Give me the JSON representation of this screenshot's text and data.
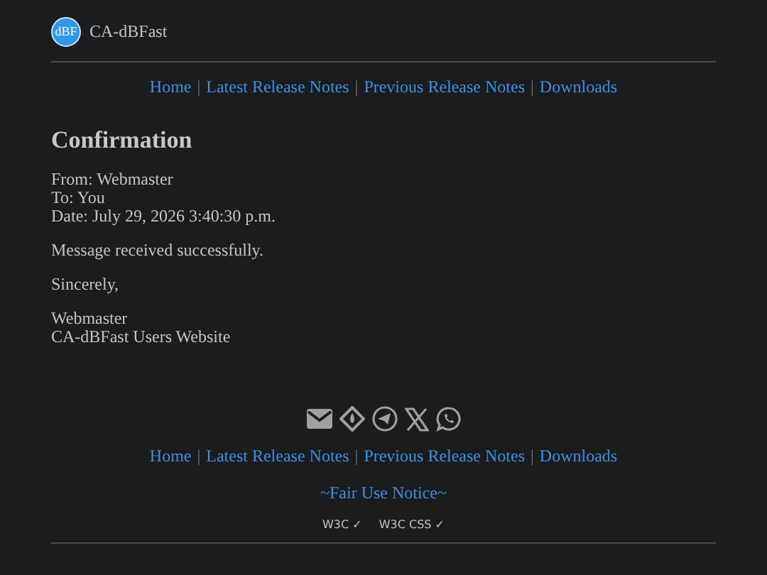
{
  "header": {
    "logo": "dBF",
    "site_name": "CA-dBFast"
  },
  "nav_top": {
    "separator": "|",
    "links": [
      "Home",
      "Latest Release Notes",
      "Previous Release Notes",
      "Downloads"
    ]
  },
  "content": {
    "title": "Confirmation",
    "meta": [
      "From: Webmaster",
      "To: You",
      "Date: July 29, 2026 3:40:30 p.m."
    ],
    "message": "Message received successfully.",
    "closing": "Sincerely,",
    "signature": [
      "Webmaster",
      "CA-dBFast Users Website"
    ]
  },
  "share_icons": [
    {
      "kind": "mail"
    },
    {
      "kind": "diamond"
    },
    {
      "kind": "telegram"
    },
    {
      "kind": "x"
    },
    {
      "kind": "whatsapp"
    }
  ],
  "nav_bottom": {
    "separator": "|",
    "links": [
      "Home",
      "Latest Release Notes",
      "Previous Release Notes",
      "Downloads"
    ]
  },
  "fair_use": "~Fair Use Notice~",
  "badges": [
    "W3C ✓",
    "W3C CSS ✓"
  ]
}
